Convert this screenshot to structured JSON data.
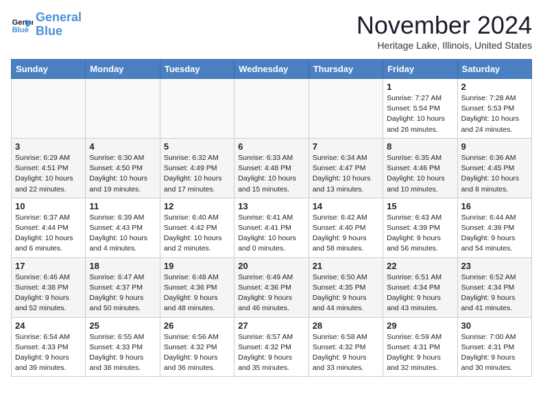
{
  "header": {
    "logo_line1": "General",
    "logo_line2": "Blue",
    "month_title": "November 2024",
    "location": "Heritage Lake, Illinois, United States"
  },
  "calendar": {
    "days_of_week": [
      "Sunday",
      "Monday",
      "Tuesday",
      "Wednesday",
      "Thursday",
      "Friday",
      "Saturday"
    ],
    "weeks": [
      [
        {
          "day": "",
          "info": ""
        },
        {
          "day": "",
          "info": ""
        },
        {
          "day": "",
          "info": ""
        },
        {
          "day": "",
          "info": ""
        },
        {
          "day": "",
          "info": ""
        },
        {
          "day": "1",
          "info": "Sunrise: 7:27 AM\nSunset: 5:54 PM\nDaylight: 10 hours and 26 minutes."
        },
        {
          "day": "2",
          "info": "Sunrise: 7:28 AM\nSunset: 5:53 PM\nDaylight: 10 hours and 24 minutes."
        }
      ],
      [
        {
          "day": "3",
          "info": "Sunrise: 6:29 AM\nSunset: 4:51 PM\nDaylight: 10 hours and 22 minutes."
        },
        {
          "day": "4",
          "info": "Sunrise: 6:30 AM\nSunset: 4:50 PM\nDaylight: 10 hours and 19 minutes."
        },
        {
          "day": "5",
          "info": "Sunrise: 6:32 AM\nSunset: 4:49 PM\nDaylight: 10 hours and 17 minutes."
        },
        {
          "day": "6",
          "info": "Sunrise: 6:33 AM\nSunset: 4:48 PM\nDaylight: 10 hours and 15 minutes."
        },
        {
          "day": "7",
          "info": "Sunrise: 6:34 AM\nSunset: 4:47 PM\nDaylight: 10 hours and 13 minutes."
        },
        {
          "day": "8",
          "info": "Sunrise: 6:35 AM\nSunset: 4:46 PM\nDaylight: 10 hours and 10 minutes."
        },
        {
          "day": "9",
          "info": "Sunrise: 6:36 AM\nSunset: 4:45 PM\nDaylight: 10 hours and 8 minutes."
        }
      ],
      [
        {
          "day": "10",
          "info": "Sunrise: 6:37 AM\nSunset: 4:44 PM\nDaylight: 10 hours and 6 minutes."
        },
        {
          "day": "11",
          "info": "Sunrise: 6:39 AM\nSunset: 4:43 PM\nDaylight: 10 hours and 4 minutes."
        },
        {
          "day": "12",
          "info": "Sunrise: 6:40 AM\nSunset: 4:42 PM\nDaylight: 10 hours and 2 minutes."
        },
        {
          "day": "13",
          "info": "Sunrise: 6:41 AM\nSunset: 4:41 PM\nDaylight: 10 hours and 0 minutes."
        },
        {
          "day": "14",
          "info": "Sunrise: 6:42 AM\nSunset: 4:40 PM\nDaylight: 9 hours and 58 minutes."
        },
        {
          "day": "15",
          "info": "Sunrise: 6:43 AM\nSunset: 4:39 PM\nDaylight: 9 hours and 56 minutes."
        },
        {
          "day": "16",
          "info": "Sunrise: 6:44 AM\nSunset: 4:39 PM\nDaylight: 9 hours and 54 minutes."
        }
      ],
      [
        {
          "day": "17",
          "info": "Sunrise: 6:46 AM\nSunset: 4:38 PM\nDaylight: 9 hours and 52 minutes."
        },
        {
          "day": "18",
          "info": "Sunrise: 6:47 AM\nSunset: 4:37 PM\nDaylight: 9 hours and 50 minutes."
        },
        {
          "day": "19",
          "info": "Sunrise: 6:48 AM\nSunset: 4:36 PM\nDaylight: 9 hours and 48 minutes."
        },
        {
          "day": "20",
          "info": "Sunrise: 6:49 AM\nSunset: 4:36 PM\nDaylight: 9 hours and 46 minutes."
        },
        {
          "day": "21",
          "info": "Sunrise: 6:50 AM\nSunset: 4:35 PM\nDaylight: 9 hours and 44 minutes."
        },
        {
          "day": "22",
          "info": "Sunrise: 6:51 AM\nSunset: 4:34 PM\nDaylight: 9 hours and 43 minutes."
        },
        {
          "day": "23",
          "info": "Sunrise: 6:52 AM\nSunset: 4:34 PM\nDaylight: 9 hours and 41 minutes."
        }
      ],
      [
        {
          "day": "24",
          "info": "Sunrise: 6:54 AM\nSunset: 4:33 PM\nDaylight: 9 hours and 39 minutes."
        },
        {
          "day": "25",
          "info": "Sunrise: 6:55 AM\nSunset: 4:33 PM\nDaylight: 9 hours and 38 minutes."
        },
        {
          "day": "26",
          "info": "Sunrise: 6:56 AM\nSunset: 4:32 PM\nDaylight: 9 hours and 36 minutes."
        },
        {
          "day": "27",
          "info": "Sunrise: 6:57 AM\nSunset: 4:32 PM\nDaylight: 9 hours and 35 minutes."
        },
        {
          "day": "28",
          "info": "Sunrise: 6:58 AM\nSunset: 4:32 PM\nDaylight: 9 hours and 33 minutes."
        },
        {
          "day": "29",
          "info": "Sunrise: 6:59 AM\nSunset: 4:31 PM\nDaylight: 9 hours and 32 minutes."
        },
        {
          "day": "30",
          "info": "Sunrise: 7:00 AM\nSunset: 4:31 PM\nDaylight: 9 hours and 30 minutes."
        }
      ]
    ]
  }
}
